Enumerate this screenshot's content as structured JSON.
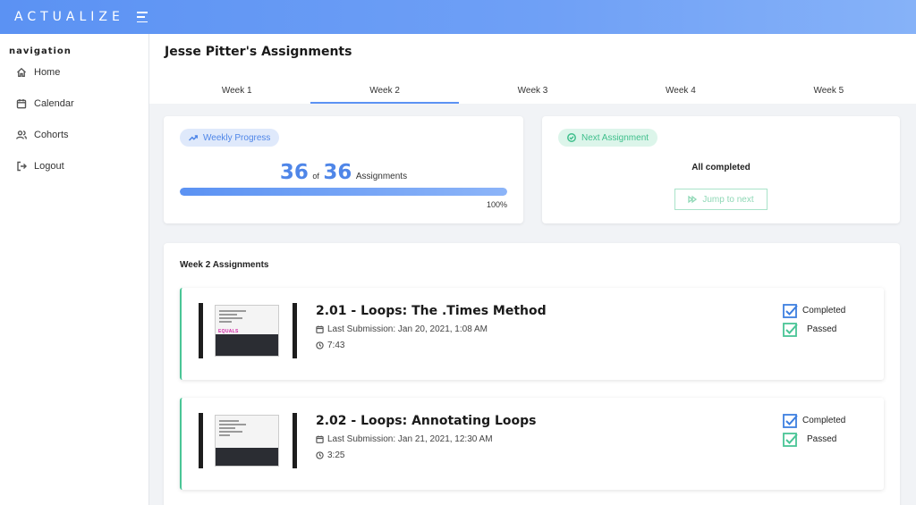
{
  "brand": "ACTUALIZE",
  "sidebar": {
    "title": "navigation",
    "items": [
      {
        "label": "Home"
      },
      {
        "label": "Calendar"
      },
      {
        "label": "Cohorts"
      },
      {
        "label": "Logout"
      }
    ]
  },
  "page": {
    "title": "Jesse Pitter's Assignments",
    "tabs": [
      {
        "label": "Week 1"
      },
      {
        "label": "Week 2"
      },
      {
        "label": "Week 3"
      },
      {
        "label": "Week 4"
      },
      {
        "label": "Week 5"
      }
    ],
    "active_tab": "Week 2"
  },
  "progress": {
    "pill_label": "Weekly Progress",
    "completed": "36",
    "of_label": "of",
    "total": "36",
    "unit_label": "Assignments",
    "percent_label": "100%",
    "percent_value": 100
  },
  "next": {
    "pill_label": "Next Assignment",
    "status": "All completed",
    "button_label": "Jump to next"
  },
  "list": {
    "title": "Week 2 Assignments",
    "items": [
      {
        "title": "2.01 - Loops: The .Times Method",
        "last_submission": "Last Submission: Jan 20, 2021, 1:08 AM",
        "duration": "7:43",
        "status_completed": "Completed",
        "status_passed": "Passed"
      },
      {
        "title": "2.02 - Loops: Annotating Loops",
        "last_submission": "Last Submission: Jan 21, 2021, 12:30 AM",
        "duration": "3:25",
        "status_completed": "Completed",
        "status_passed": "Passed"
      }
    ]
  },
  "colors": {
    "accent_blue": "#5b92f3",
    "accent_green": "#49c596",
    "background": "#f1f3f6"
  },
  "icons": {
    "menu": "menu-icon",
    "home": "home-icon",
    "calendar": "calendar-icon",
    "cohorts": "users-icon",
    "logout": "logout-icon",
    "trend": "trending-up-icon",
    "check_circle": "check-circle-icon",
    "forward": "fast-forward-icon",
    "clock": "clock-icon",
    "checkbox": "checkbox-checked-icon"
  }
}
